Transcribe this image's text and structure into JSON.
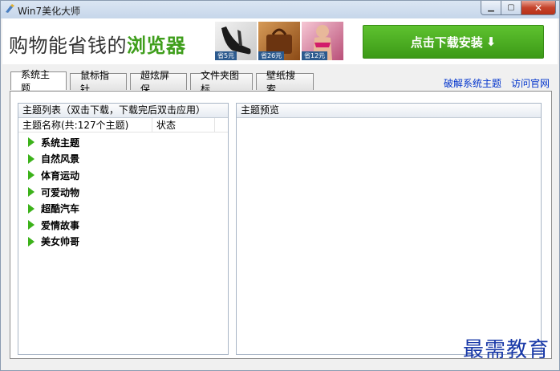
{
  "window": {
    "title": "Win7美化大师"
  },
  "banner": {
    "slogan_prefix": "购物能省钱的",
    "slogan_highlight": "浏览器",
    "products": [
      {
        "price_tag": "省5元"
      },
      {
        "price_tag": "省26元"
      },
      {
        "price_tag": "省12元"
      }
    ],
    "install_label": "点击下载安装",
    "install_icon": "download-arrow-icon"
  },
  "tabs": [
    {
      "label": "系统主题",
      "active": true
    },
    {
      "label": "鼠标指针",
      "active": false
    },
    {
      "label": "超炫屏保",
      "active": false
    },
    {
      "label": "文件夹图标",
      "active": false
    },
    {
      "label": "壁纸搜索",
      "active": false
    }
  ],
  "links": {
    "crack": "破解系统主题",
    "visit": "访问官网"
  },
  "theme_panel": {
    "header": "主题列表（双击下载，下载完后双击应用）",
    "col_name": "主题名称(共:127个主题)",
    "col_status": "状态",
    "items": [
      "系统主题",
      "自然风景",
      "体育运动",
      "可爱动物",
      "超酷汽车",
      "爱情故事",
      "美女帅哥"
    ]
  },
  "preview_panel": {
    "header": "主题预览"
  },
  "watermark": "最需教育",
  "colors": {
    "accent_green": "#3f9e1c",
    "link_blue": "#0033cc",
    "arrow_green": "#3cb21a"
  }
}
